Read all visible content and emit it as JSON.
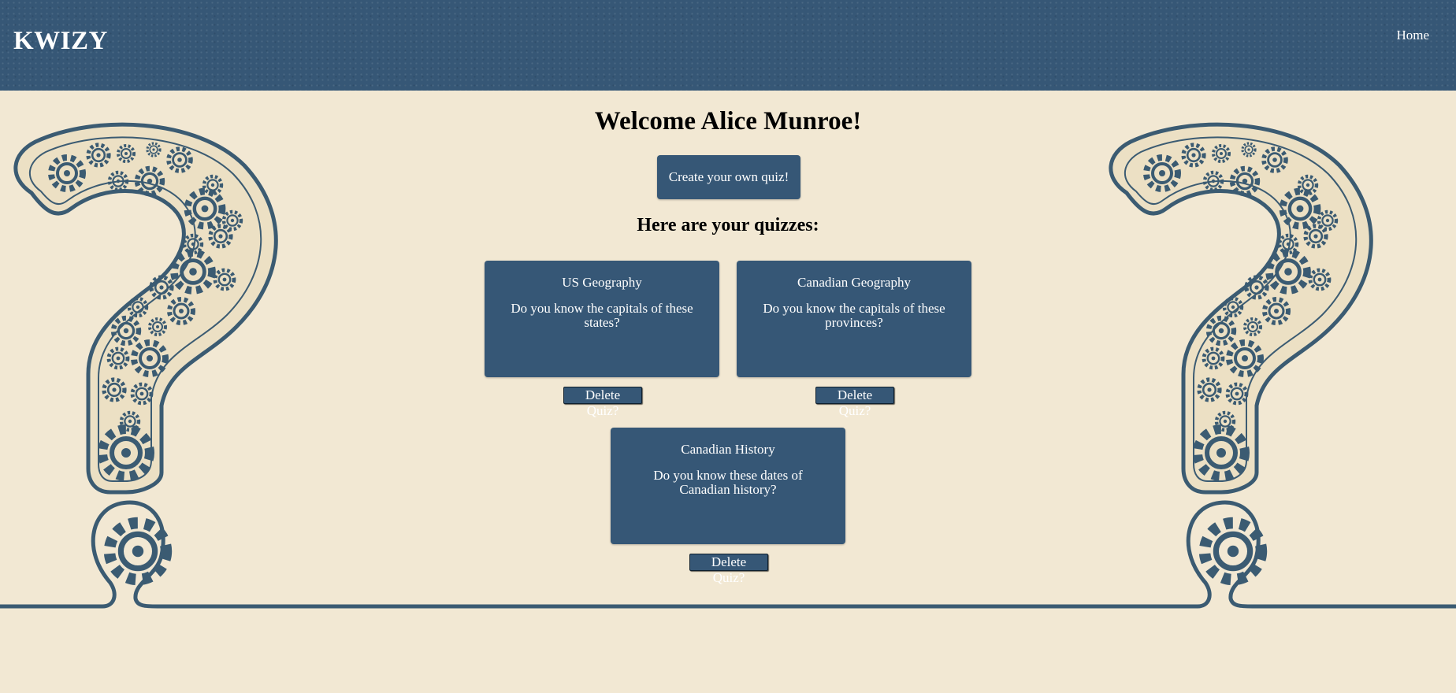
{
  "header": {
    "brand": "KWIZY",
    "nav": {
      "home": "Home"
    }
  },
  "main": {
    "welcome": "Welcome Alice Munroe!",
    "create_button": "Create your own quiz!",
    "quizzes_heading": "Here are your quizzes:",
    "quizzes": [
      {
        "title": "US Geography",
        "description": "Do you know the capitals of these states?",
        "delete_label": "Delete Quiz?"
      },
      {
        "title": "Canadian Geography",
        "description": "Do you know the capitals of these provinces?",
        "delete_label": "Delete Quiz?"
      },
      {
        "title": "Canadian History",
        "description": "Do you know these dates of Canadian history?",
        "delete_label": "Delete Quiz?"
      }
    ]
  },
  "colors": {
    "primary": "#365776",
    "background": "#f2e8d3",
    "line": "#3b5b72"
  }
}
